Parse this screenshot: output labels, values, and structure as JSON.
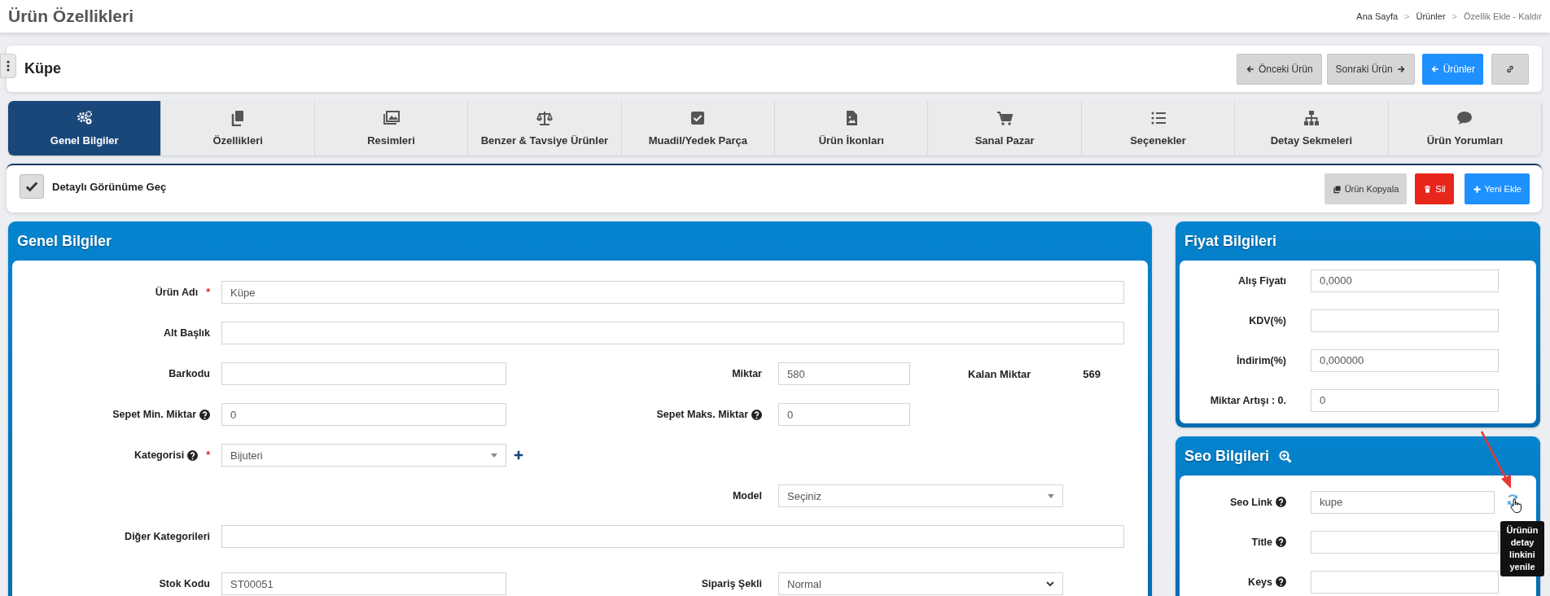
{
  "page_header": {
    "title": "Ürün Özellikleri",
    "separator": ">",
    "breadcrumb": [
      {
        "label": "Ana Sayfa"
      },
      {
        "label": "Ürünler"
      },
      {
        "label": "Özellik Ekle - Kaldır"
      }
    ]
  },
  "product_bar": {
    "title": "Küpe",
    "buttons": [
      {
        "kind": "previous",
        "label": "Önceki Ürün"
      },
      {
        "kind": "next",
        "label": "Sonraki Ürün"
      },
      {
        "kind": "back",
        "label": "Ürünler"
      },
      {
        "kind": "link"
      }
    ]
  },
  "tabs": [
    {
      "label": "Genel Bilgiler",
      "selected": true
    },
    {
      "label": "Özellikleri",
      "selected": false
    },
    {
      "label": "Resimleri",
      "selected": false
    },
    {
      "label": "Benzer & Tavsiye Ürünler",
      "selected": false
    },
    {
      "label": "Muadil/Yedek Parça",
      "selected": false
    },
    {
      "label": "Ürün İkonları",
      "selected": false
    },
    {
      "label": "Sanal Pazar",
      "selected": false
    },
    {
      "label": "Seçenekler",
      "selected": false
    },
    {
      "label": "Detay Sekmeleri",
      "selected": false
    },
    {
      "label": "Ürün Yorumları",
      "selected": false
    }
  ],
  "toolbar": {
    "checkbox": {
      "label": "Detaylı Görünüme Geç",
      "checked": true
    },
    "buttons": [
      {
        "kind": "copy",
        "label": "Ürün Kopyala"
      },
      {
        "kind": "delete",
        "label": "Sil"
      },
      {
        "kind": "add",
        "label": "Yeni Ekle"
      }
    ]
  },
  "general_panel": {
    "title": "Genel Bilgiler",
    "rows": [
      {
        "full": {
          "label": "Ürün Adı",
          "required_mark": "*",
          "kind": "text",
          "value": "Küpe"
        }
      },
      {
        "full": {
          "label": "Alt Başlık",
          "kind": "text"
        }
      },
      {
        "left": {
          "label": "Barkodu",
          "kind": "text"
        },
        "right": {
          "label": "Miktar",
          "kind": "text",
          "value": "580"
        },
        "extra": {
          "label": "Kalan Miktar",
          "value": "569"
        }
      },
      {
        "left": {
          "label": "Sepet Min. Miktar",
          "help": true,
          "kind": "text",
          "value": "0"
        },
        "right": {
          "label": "Sepet Maks. Miktar",
          "help": true,
          "kind": "text",
          "value": "0"
        }
      },
      {
        "left": {
          "label": "Kategorisi",
          "help": true,
          "required_mark": "*",
          "kind": "select",
          "value": "Bijuteri",
          "add_button": true
        }
      },
      {
        "right": {
          "label": "Model",
          "kind": "select",
          "value": "Seçiniz"
        }
      },
      {
        "full": {
          "label": "Diğer Kategorileri",
          "kind": "text"
        }
      },
      {
        "left": {
          "label": "Stok Kodu",
          "kind": "text",
          "value": "ST00051"
        },
        "right": {
          "label": "Sipariş Şekli",
          "kind": "native-select",
          "value": "Normal"
        }
      }
    ]
  },
  "price_panel": {
    "title": "Fiyat Bilgileri",
    "fields": [
      {
        "label": "Alış Fiyatı",
        "value": "0,0000"
      },
      {
        "label": "KDV(%)"
      },
      {
        "label": "İndirim(%)",
        "value": "0,000000"
      },
      {
        "label": "Miktar Artışı : 0.",
        "value": "0"
      }
    ]
  },
  "seo_panel": {
    "title": "Seo Bilgileri",
    "fields": [
      {
        "label": "Seo Link",
        "help": true,
        "value": "kupe",
        "refresh_button": true
      },
      {
        "label": "Title",
        "help": true
      },
      {
        "label": "Keys",
        "help": true
      }
    ],
    "tooltip": "Ürünün detay linkini yenile"
  }
}
